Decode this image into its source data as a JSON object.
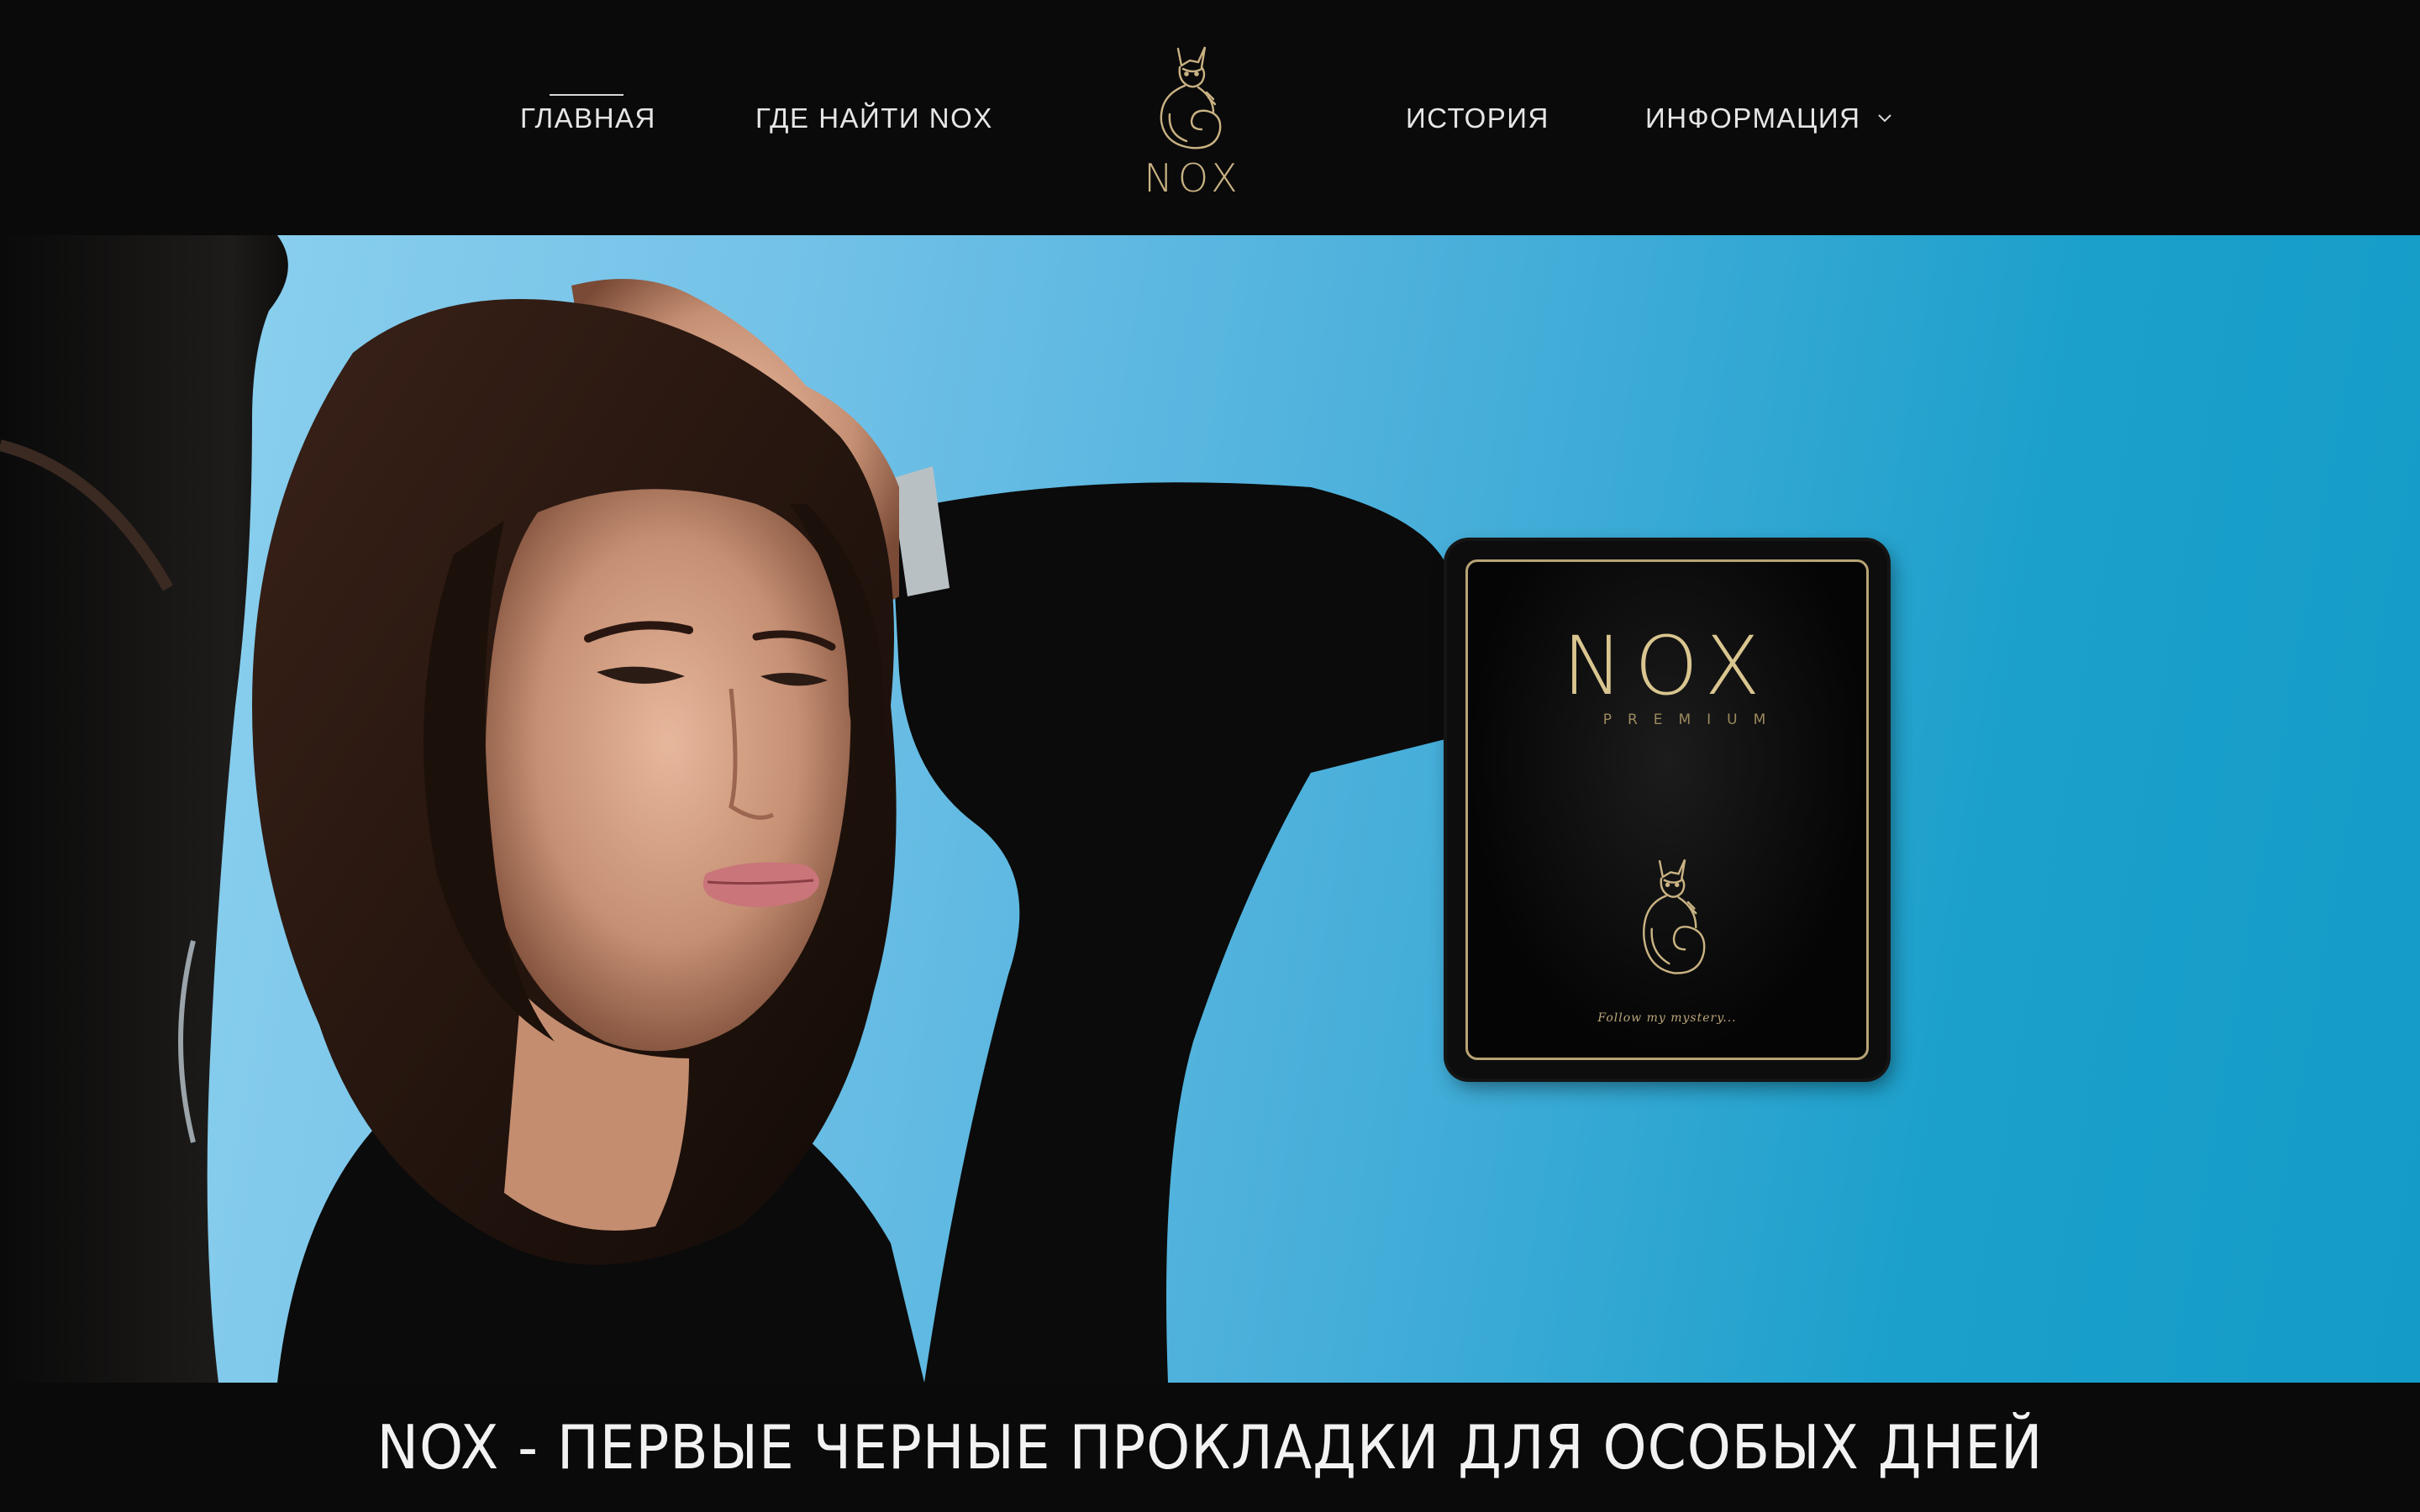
{
  "header": {
    "nav": [
      {
        "label": "ГЛАВНАЯ",
        "active": true
      },
      {
        "label": "ГДЕ НАЙТИ NOX"
      },
      {
        "label": "ИСТОРИЯ"
      },
      {
        "label": "ИНФОРМАЦИЯ",
        "has_dropdown": true
      }
    ],
    "logo_text": "NOX"
  },
  "hero": {
    "package": {
      "brand": "NOX",
      "subtitle": "PREMIUM",
      "tagline": "Follow my mystery..."
    }
  },
  "banner": {
    "text": "NOX - ПЕРВЫЕ ЧЕРНЫЕ ПРОКЛАДКИ ДЛЯ ОСОБЫХ ДНЕЙ"
  },
  "colors": {
    "header_bg": "#0a0a0a",
    "accent_gold": "#d9c58f",
    "sky_light": "#93d4f0",
    "sky_deep": "#149bc7",
    "text_light": "#e6e6e6"
  },
  "icons": {
    "logo": "cat-logo-icon",
    "dropdown": "chevron-down-icon"
  }
}
